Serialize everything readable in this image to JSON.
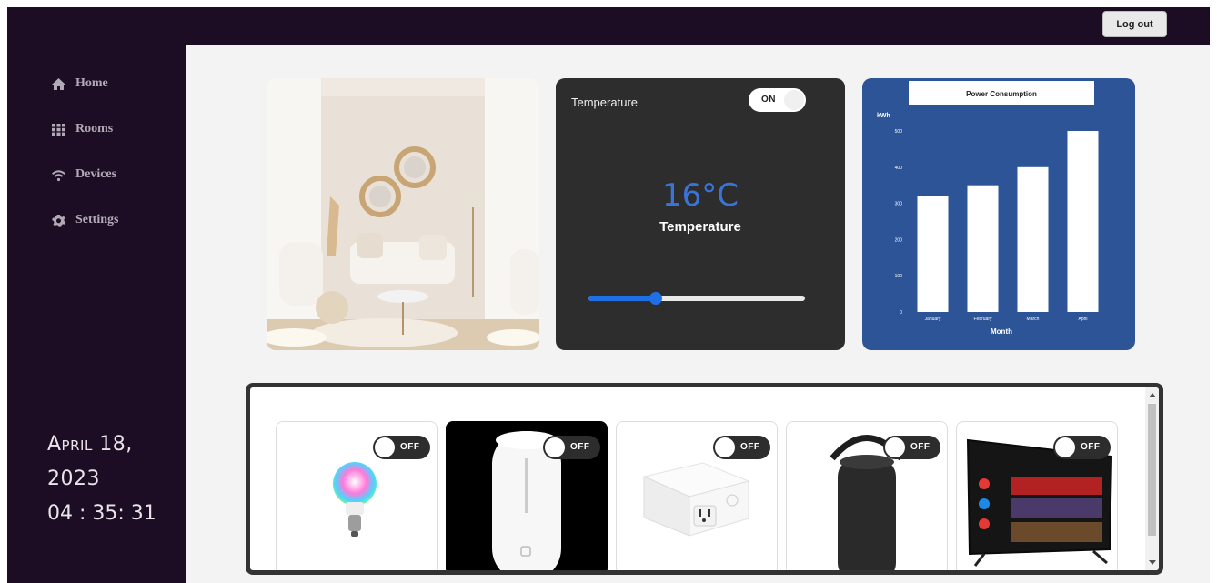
{
  "header": {
    "logout_label": "Log out"
  },
  "sidebar": {
    "items": [
      {
        "label": "Home",
        "icon": "home-icon"
      },
      {
        "label": "Rooms",
        "icon": "grid-icon"
      },
      {
        "label": "Devices",
        "icon": "wifi-icon"
      },
      {
        "label": "Settings",
        "icon": "gear-icon"
      }
    ]
  },
  "datetime": {
    "date_line1": "April 18,",
    "date_line2": "2023",
    "time": "04 : 35: 31"
  },
  "temperature": {
    "label": "Temperature",
    "toggle_label": "ON",
    "value": "16°C",
    "subtitle": "Temperature",
    "slider_fraction": 0.31,
    "accent": "#1f6fe5"
  },
  "chart_data": {
    "type": "bar",
    "title": "Power Consumption",
    "xlabel": "Month",
    "ylabel": "kWh",
    "categories": [
      "January",
      "February",
      "March",
      "April"
    ],
    "values": [
      320,
      350,
      400,
      500
    ],
    "ylim": [
      0,
      500
    ],
    "yticks": [
      0,
      100,
      200,
      300,
      400,
      500
    ],
    "grid": false,
    "background": "#2d5497",
    "bar_color": "#ffffff"
  },
  "devices": [
    {
      "name": "smart-bulb",
      "toggle_label": "OFF"
    },
    {
      "name": "humidifier",
      "toggle_label": "OFF"
    },
    {
      "name": "smart-plug",
      "toggle_label": "OFF"
    },
    {
      "name": "speaker",
      "toggle_label": "OFF"
    },
    {
      "name": "tv",
      "toggle_label": "OFF"
    }
  ],
  "colors": {
    "sidebar": "#1c0d24",
    "main_bg": "#f3f3f3",
    "card_dark": "#2d2d2d"
  }
}
